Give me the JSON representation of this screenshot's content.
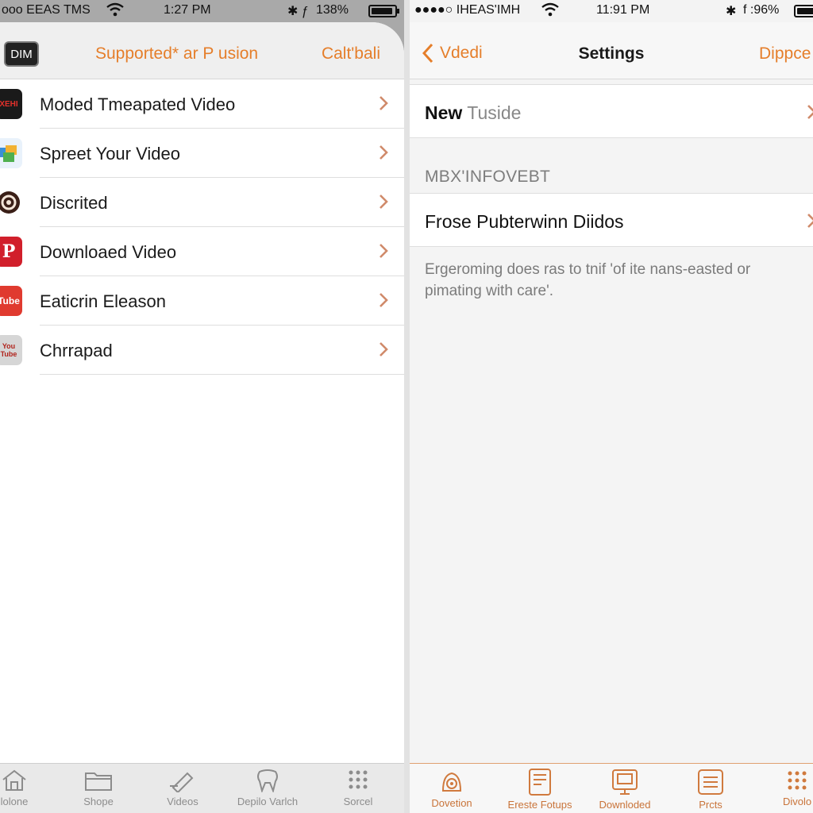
{
  "left_screen": {
    "status_bar": {
      "carrier": "ooo EEAS TMS",
      "time": "1:27 PM",
      "battery_percent": "138%"
    },
    "header": {
      "badge": "DIM",
      "title": "Supported* ar P usion",
      "action": "Calt'bali"
    },
    "items": [
      {
        "label": "Moded Tmeapated Video",
        "icon": "netflix-app-icon",
        "icon_text": "XEHI",
        "icon_color": "#b3131b"
      },
      {
        "label": "Spreet Your Video",
        "icon": "photos-app-icon",
        "icon_text": "",
        "icon_color": "#3a8fd6"
      },
      {
        "label": "Discrited",
        "icon": "disc-app-icon",
        "icon_text": "",
        "icon_color": "#5a2b1e"
      },
      {
        "label": "Downloaed Video",
        "icon": "pinterest-app-icon",
        "icon_text": "P",
        "icon_color": "#d11f2b"
      },
      {
        "label": "Eaticrin Eleason",
        "icon": "youtube-app-icon",
        "icon_text": "Tube",
        "icon_color": "#e03a2f"
      },
      {
        "label": "Chrrapad",
        "icon": "youtube-classic-app-icon",
        "icon_text": "You Tube",
        "icon_color": "#cccccc"
      }
    ],
    "tabbar": [
      {
        "label": "lolone",
        "icon": "home-icon"
      },
      {
        "label": "Shope",
        "icon": "folder-icon"
      },
      {
        "label": "Videos",
        "icon": "pencil-icon"
      },
      {
        "label": "Depilo Varlch",
        "icon": "tooth-icon"
      },
      {
        "label": "Sorcel",
        "icon": "grid-icon"
      }
    ]
  },
  "right_screen": {
    "status_bar": {
      "carrier": "●●●●○ IHEAS'IMH",
      "time": "11:91 PM",
      "battery_percent": "f :96%"
    },
    "nav": {
      "back_label": "Vdedi",
      "title": "Settings",
      "right_label": "Dippce"
    },
    "cell_new": {
      "bold": "New",
      "muted": "Tuside"
    },
    "section_header": "MBX'INFOVEBT",
    "cell_frose": "Frose Pubterwinn Diidos",
    "footnote": "Ergeroming does ras to tnif 'of ite nans-easted or pimating with care'.",
    "tabbar": [
      {
        "label": "Dovetion",
        "icon": "camera-icon"
      },
      {
        "label": "Ereste Fotups",
        "icon": "tablet-icon"
      },
      {
        "label": "Downloded",
        "icon": "download-monitor-icon"
      },
      {
        "label": "Prcts",
        "icon": "list-icon"
      },
      {
        "label": "Divolo",
        "icon": "dots-grid-icon"
      }
    ]
  },
  "colors": {
    "accent": "#e57e2a",
    "text": "#1a1a1a",
    "muted": "#888888"
  }
}
